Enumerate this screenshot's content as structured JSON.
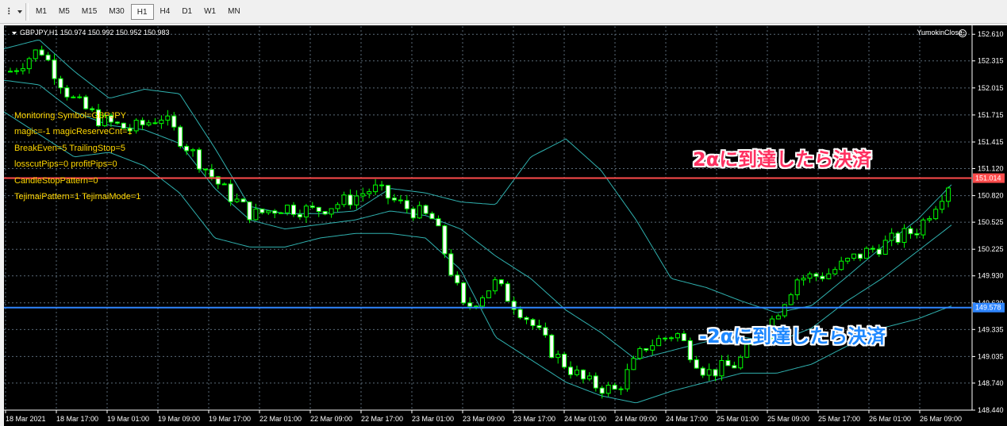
{
  "toolbar": {
    "tool_icon": "line-tools-icon",
    "timeframes": [
      {
        "label": "M1",
        "active": false
      },
      {
        "label": "M5",
        "active": false
      },
      {
        "label": "M15",
        "active": false
      },
      {
        "label": "M30",
        "active": false
      },
      {
        "label": "H1",
        "active": true
      },
      {
        "label": "H4",
        "active": false
      },
      {
        "label": "D1",
        "active": false
      },
      {
        "label": "W1",
        "active": false
      },
      {
        "label": "MN",
        "active": false
      }
    ]
  },
  "chart": {
    "header": "GBPJPY,H1  150.974 150.992 150.952 150.983",
    "ea_name": "YumokinClose",
    "ea_icon": "smiley-icon",
    "info_lines": [
      "Monitoring Symbol=GBPJPY",
      "magic=-1 magicReserveCnt=1",
      "BreakEven=5 TrailingStop=5",
      "losscutPips=0 profitPips=0",
      "CandleStopPattern=0",
      "TejimaiPattern=1 TejimaiMode=1"
    ],
    "annotations": {
      "upper": "2αに到達したら決済",
      "lower": "-2αに到達したら決済"
    },
    "colors": {
      "background": "#000000",
      "grid": "#5a6a78",
      "candle": "#00ff00",
      "candle_up_body": "#000000",
      "candle_down_body": "#ffffff",
      "band": "#2fb0ae",
      "upper_line": "#ff4c4c",
      "lower_line": "#2f86ff",
      "upper_text": "#ff3060",
      "lower_text": "#1e88ff",
      "info_text": "#ffd700"
    }
  },
  "chart_data": {
    "type": "candlestick",
    "symbol": "GBPJPY",
    "timeframe": "H1",
    "y_ticks": [
      "152.610",
      "152.315",
      "152.015",
      "151.715",
      "151.415",
      "151.120",
      "150.820",
      "150.525",
      "150.225",
      "149.930",
      "149.630",
      "149.335",
      "149.035",
      "148.740",
      "148.440"
    ],
    "ylim": [
      148.44,
      152.7
    ],
    "x_ticks": [
      "18 Mar 2021",
      "18 Mar 17:00",
      "19 Mar 01:00",
      "19 Mar 09:00",
      "19 Mar 17:00",
      "22 Mar 01:00",
      "22 Mar 09:00",
      "22 Mar 17:00",
      "23 Mar 01:00",
      "23 Mar 09:00",
      "23 Mar 17:00",
      "24 Mar 01:00",
      "24 Mar 09:00",
      "24 Mar 17:00",
      "25 Mar 01:00",
      "25 Mar 09:00",
      "25 Mar 17:00",
      "26 Mar 01:00",
      "26 Mar 09:00"
    ],
    "horizontal_lines": [
      {
        "label": "151.014",
        "value": 151.014
      },
      {
        "label": "149.578",
        "value": 149.578
      }
    ],
    "bollinger_bands": {
      "upper_anchors": [
        152.45,
        152.55,
        152.2,
        151.9,
        152.0,
        151.95,
        151.35,
        150.7,
        150.62,
        150.62,
        150.65,
        150.9,
        150.85,
        150.75,
        150.72,
        151.25,
        151.45,
        151.1,
        150.55,
        149.9,
        149.8,
        149.65,
        149.52,
        149.6,
        149.92,
        150.25,
        150.55,
        150.95
      ],
      "middle_anchors": [
        152.1,
        152.05,
        151.75,
        151.6,
        151.55,
        151.4,
        150.9,
        150.55,
        150.45,
        150.5,
        150.55,
        150.65,
        150.6,
        150.45,
        150.15,
        149.9,
        149.55,
        149.3,
        149.0,
        149.1,
        149.2,
        149.25,
        149.2,
        149.35,
        149.65,
        149.9,
        150.2,
        150.5
      ],
      "lower_anchors": [
        151.75,
        151.5,
        151.25,
        151.3,
        151.15,
        150.85,
        150.35,
        150.25,
        150.25,
        150.35,
        150.4,
        150.4,
        150.35,
        150.0,
        149.25,
        149.0,
        148.75,
        148.6,
        148.52,
        148.65,
        148.75,
        148.85,
        148.85,
        148.95,
        149.15,
        149.35,
        149.45,
        149.6
      ]
    },
    "candle_anchors": [
      152.2,
      152.45,
      151.9,
      151.65,
      151.55,
      151.7,
      151.3,
      150.9,
      150.6,
      150.7,
      150.65,
      150.75,
      150.9,
      150.7,
      150.55,
      149.55,
      149.85,
      149.5,
      149.05,
      148.75,
      148.65,
      149.15,
      149.3,
      148.85,
      148.95,
      149.35,
      149.9,
      149.95,
      150.15,
      150.3,
      150.45,
      150.95
    ]
  }
}
